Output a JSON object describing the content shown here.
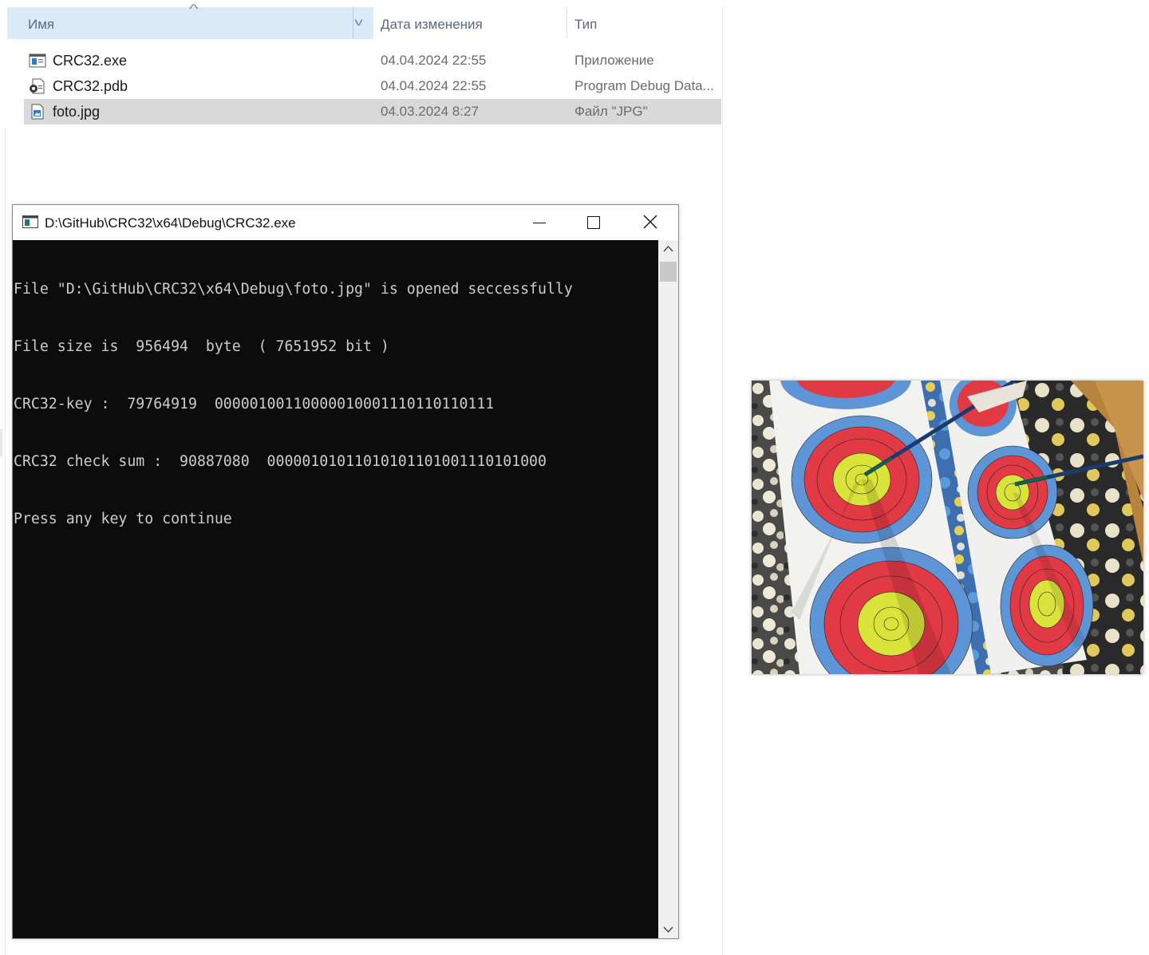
{
  "explorer": {
    "columns": {
      "name": "Имя",
      "date": "Дата изменения",
      "type": "Тип"
    },
    "files": [
      {
        "name": "CRC32.exe",
        "date": "04.04.2024 22:55",
        "type": "Приложение",
        "icon": "exe-file-icon"
      },
      {
        "name": "CRC32.pdb",
        "date": "04.04.2024 22:55",
        "type": "Program Debug Data...",
        "icon": "pdb-file-icon"
      },
      {
        "name": "foto.jpg",
        "date": "04.03.2024 8:27",
        "type": "Файл \"JPG\"",
        "icon": "jpg-file-icon",
        "selected": true
      }
    ]
  },
  "console": {
    "title": "D:\\GitHub\\CRC32\\x64\\Debug\\CRC32.exe",
    "lines": [
      "File \"D:\\GitHub\\CRC32\\x64\\Debug\\foto.jpg\" is opened seccessfully",
      "File size is  956494  byte  ( 7651952 bit )",
      "CRC32-key :  79764919  00000100110000010001110110110111",
      "CRC32 check sum :  90887080  00000101011010101101001110101000",
      "Press any key to continue"
    ]
  },
  "photo": {
    "subject": "archery-targets-with-arrows"
  },
  "colors": {
    "header_selected": "#d9ebf9",
    "row_selected": "#d9d9d9",
    "console_bg": "#0c0c0c",
    "console_text": "#cccccc"
  }
}
